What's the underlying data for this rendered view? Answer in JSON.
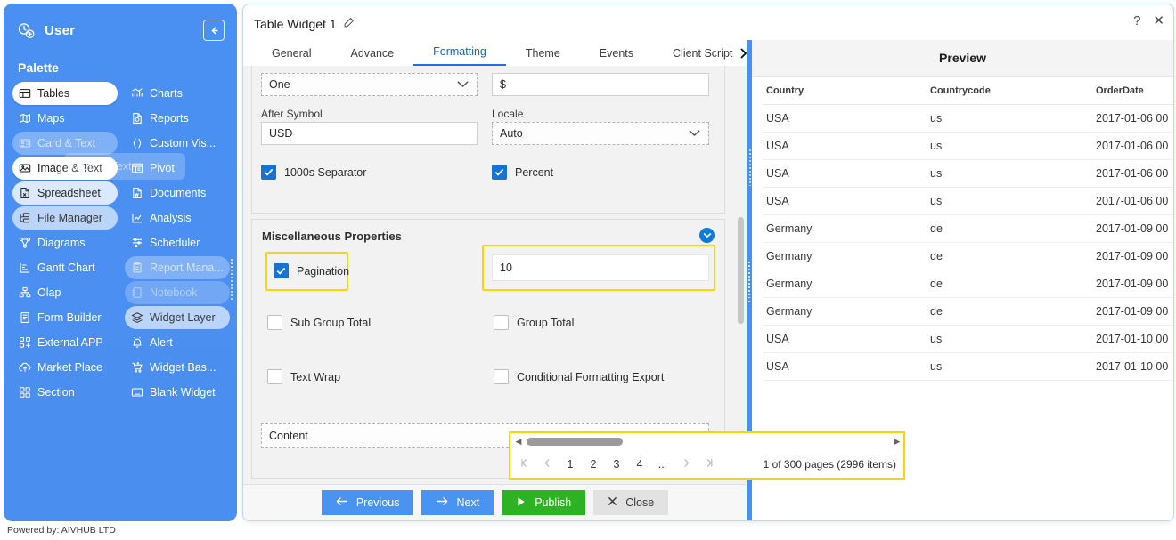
{
  "sidebar": {
    "user_label": "User",
    "palette_title": "Palette",
    "powered_by": "Powered by: AIVHUB LTD",
    "left_items": [
      {
        "label": "Tables",
        "icon": "table-icon"
      },
      {
        "label": "Maps",
        "icon": "map-icon"
      },
      {
        "label": "Card & Text",
        "icon": "card-icon"
      },
      {
        "label": "Image & Text",
        "icon": "image-icon"
      },
      {
        "label": "Spreadsheet",
        "icon": "spreadsheet-icon"
      },
      {
        "label": "File Manager",
        "icon": "file-manager-icon"
      },
      {
        "label": "Diagrams",
        "icon": "diagram-icon"
      },
      {
        "label": "Gantt Chart",
        "icon": "gantt-icon"
      },
      {
        "label": "Olap",
        "icon": "olap-icon"
      },
      {
        "label": "Form Builder",
        "icon": "form-icon"
      },
      {
        "label": "External APP",
        "icon": "external-app-icon"
      },
      {
        "label": "Market Place",
        "icon": "market-place-icon"
      },
      {
        "label": "Section",
        "icon": "section-icon"
      }
    ],
    "right_items": [
      {
        "label": "Charts",
        "icon": "chart-icon"
      },
      {
        "label": "Reports",
        "icon": "report-icon"
      },
      {
        "label": "Custom Vis...",
        "icon": "braces-icon"
      },
      {
        "label": "Pivot",
        "icon": "pivot-icon"
      },
      {
        "label": "Documents",
        "icon": "document-icon"
      },
      {
        "label": "Analysis",
        "icon": "analysis-icon"
      },
      {
        "label": "Scheduler",
        "icon": "scheduler-icon"
      },
      {
        "label": "Report Mana...",
        "icon": "report-manager-icon"
      },
      {
        "label": "Notebook",
        "icon": "notebook-icon"
      },
      {
        "label": "Widget Layer",
        "icon": "widget-layer-icon"
      },
      {
        "label": "Alert",
        "icon": "alert-bell-icon"
      },
      {
        "label": "Widget Bas...",
        "icon": "cart-icon"
      },
      {
        "label": "Blank Widget",
        "icon": "blank-widget-icon"
      }
    ],
    "drag_ghost": {
      "text_primary": "Card",
      "text_secondary": "& Text"
    }
  },
  "dialog": {
    "title": "Table Widget 1",
    "edit_icon": "pencil-edit-icon",
    "help_icon": "?",
    "close_icon": "✕",
    "tabs": [
      {
        "label": "General",
        "active": false
      },
      {
        "label": "Advance",
        "active": false
      },
      {
        "label": "Formatting",
        "active": true
      },
      {
        "label": "Theme",
        "active": false
      },
      {
        "label": "Events",
        "active": false
      },
      {
        "label": "Client Script",
        "active": false
      }
    ],
    "tab_overflow_icon": "chevron-right-icon"
  },
  "form": {
    "format_type": {
      "value": "One"
    },
    "symbol": {
      "value": "$"
    },
    "after_symbol": {
      "label": "After Symbol",
      "value": "USD"
    },
    "locale": {
      "label": "Locale",
      "value": "Auto"
    },
    "thousands_separator": {
      "label": "1000s Separator",
      "checked": true
    },
    "percent": {
      "label": "Percent",
      "checked": true
    },
    "misc_section_title": "Miscellaneous Properties",
    "pagination": {
      "label": "Pagination",
      "checked": true
    },
    "page_size": {
      "value": "10"
    },
    "sub_group_total": {
      "label": "Sub Group Total",
      "checked": false
    },
    "group_total": {
      "label": "Group Total",
      "checked": false
    },
    "text_wrap": {
      "label": "Text Wrap",
      "checked": false
    },
    "conditional_formatting_export": {
      "label": "Conditional Formatting Export",
      "checked": false
    },
    "content_select": {
      "value": "Content"
    }
  },
  "footer": {
    "previous": "Previous",
    "next": "Next",
    "publish": "Publish",
    "close": "Close"
  },
  "preview": {
    "title": "Preview",
    "columns": [
      "Country",
      "Countrycode",
      "OrderDate"
    ],
    "rows": [
      [
        "USA",
        "us",
        "2017-01-06 00"
      ],
      [
        "USA",
        "us",
        "2017-01-06 00"
      ],
      [
        "USA",
        "us",
        "2017-01-06 00"
      ],
      [
        "USA",
        "us",
        "2017-01-06 00"
      ],
      [
        "Germany",
        "de",
        "2017-01-09 00"
      ],
      [
        "Germany",
        "de",
        "2017-01-09 00"
      ],
      [
        "Germany",
        "de",
        "2017-01-09 00"
      ],
      [
        "Germany",
        "de",
        "2017-01-09 00"
      ],
      [
        "USA",
        "us",
        "2017-01-10 00"
      ],
      [
        "USA",
        "us",
        "2017-01-10 00"
      ]
    ],
    "pager": {
      "first": "≪",
      "prev": "‹",
      "pages": [
        "1",
        "2",
        "3",
        "4",
        "..."
      ],
      "next": "›",
      "last": "≫",
      "status": "1 of 300 pages (2996 items)"
    }
  },
  "colors": {
    "brand_blue": "#4a90f2",
    "accent_blue": "#1a73e8",
    "highlight_yellow": "#ffd400",
    "publish_green": "#2cb223",
    "checkbox_blue": "#1673d2"
  }
}
